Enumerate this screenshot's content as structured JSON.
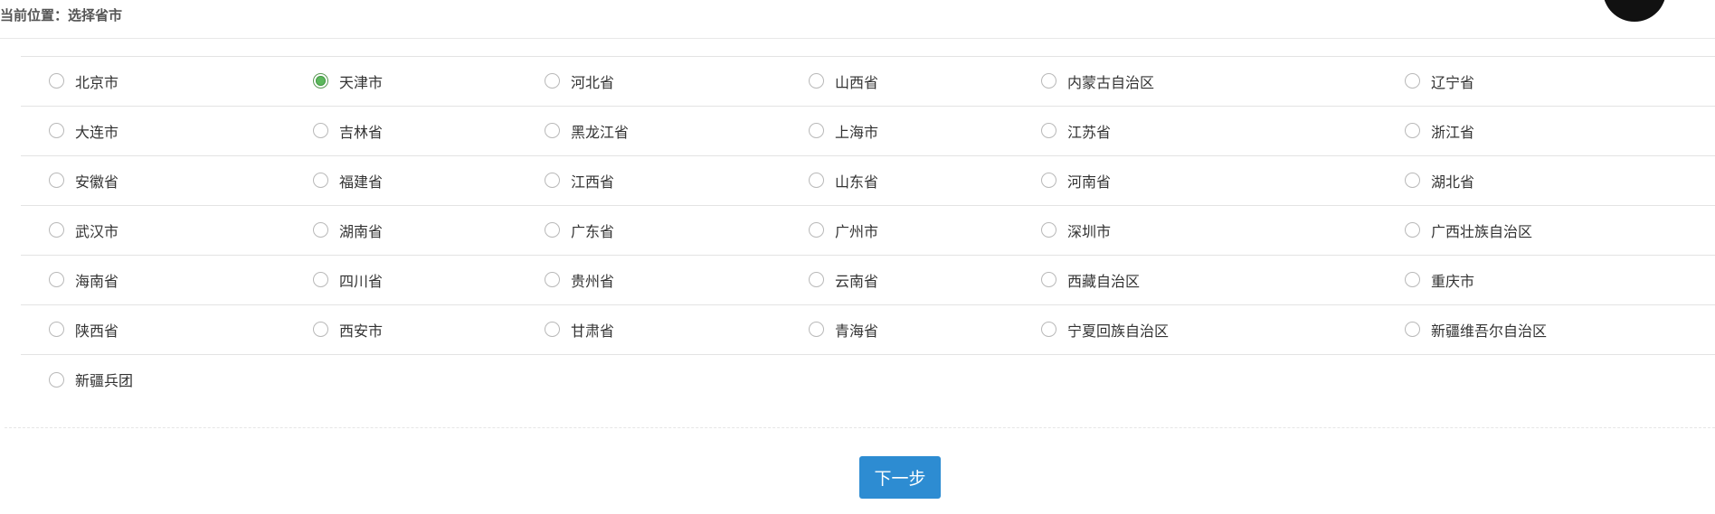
{
  "breadcrumb": "当前位置：选择省市",
  "selected": "天津市",
  "rows": [
    [
      "北京市",
      "天津市",
      "河北省",
      "山西省",
      "内蒙古自治区",
      "辽宁省"
    ],
    [
      "大连市",
      "吉林省",
      "黑龙江省",
      "上海市",
      "江苏省",
      "浙江省"
    ],
    [
      "安徽省",
      "福建省",
      "江西省",
      "山东省",
      "河南省",
      "湖北省"
    ],
    [
      "武汉市",
      "湖南省",
      "广东省",
      "广州市",
      "深圳市",
      "广西壮族自治区"
    ],
    [
      "海南省",
      "四川省",
      "贵州省",
      "云南省",
      "西藏自治区",
      "重庆市"
    ],
    [
      "陕西省",
      "西安市",
      "甘肃省",
      "青海省",
      "宁夏回族自治区",
      "新疆维吾尔自治区"
    ],
    [
      "新疆兵团"
    ]
  ],
  "next_button": "下一步",
  "colors": {
    "primary": "#2d8cd2",
    "checked": "#5cb85c"
  }
}
